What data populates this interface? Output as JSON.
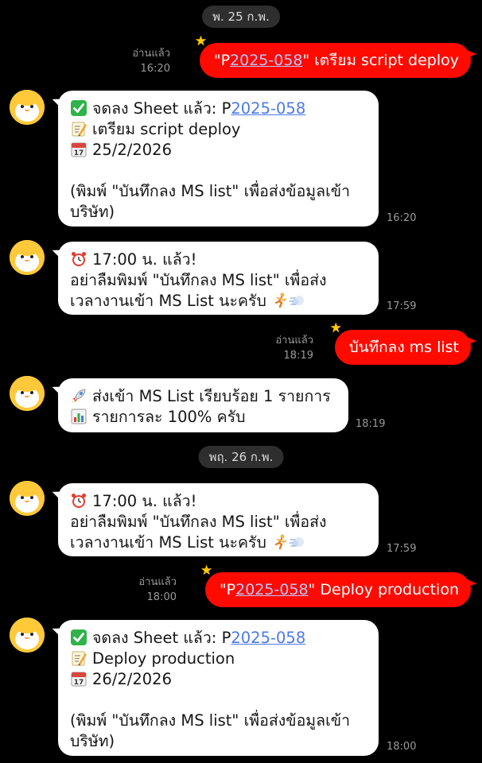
{
  "dates": {
    "d1": "พ. 25 ก.พ.",
    "d2": "พฤ. 26 ก.พ."
  },
  "read_label": "อ่านแล้ว",
  "outgoing": [
    {
      "time": "16:20",
      "pre": "\"P",
      "link": "2025-058",
      "post": "\" เตรียม script deploy"
    },
    {
      "time": "18:19",
      "text": "บันทึกลง ms list"
    },
    {
      "time": "18:00",
      "pre": "\"P",
      "link": "2025-058",
      "post": "\" Deploy production"
    }
  ],
  "incoming": [
    {
      "time": "16:20",
      "line1_pre": "จดลง Sheet แล้ว: P",
      "line1_link": "2025-058",
      "line2": "เตรียม script deploy",
      "line3": "25/2/2026",
      "line4": "(พิมพ์ \"บันทึกลง MS list\" เพื่อส่งข้อมูลเข้า",
      "line5": "บริษัท)"
    },
    {
      "time": "17:59",
      "line1": "17:00 น. แล้ว!",
      "line2": "อย่าลืมพิมพ์ \"บันทึกลง MS list\" เพื่อส่ง",
      "line3": "เวลางานเข้า MS List นะครับ"
    },
    {
      "time": "18:19",
      "line1": "ส่งเข้า MS List เรียบร้อย 1 รายการ",
      "line2": "รายการละ 100% ครับ"
    },
    {
      "time": "17:59",
      "line1": "17:00 น. แล้ว!",
      "line2": "อย่าลืมพิมพ์ \"บันทึกลง MS list\" เพื่อส่ง",
      "line3": "เวลางานเข้า MS List นะครับ"
    },
    {
      "time": "18:00",
      "line1_pre": "จดลง Sheet แล้ว: P",
      "line1_link": "2025-058",
      "line2": "Deploy production",
      "line3": "26/2/2026",
      "line4": "(พิมพ์ \"บันทึกลง MS list\" เพื่อส่งข้อมูลเข้า",
      "line5": "บริษัท)"
    }
  ],
  "icons": {
    "check": "check-mark-icon",
    "memo": "memo-icon",
    "calendar": "calendar-icon",
    "alarm": "alarm-clock-icon",
    "runner": "running-person-icon",
    "dash": "dash-icon",
    "rocket": "rocket-icon",
    "chart": "bar-chart-icon",
    "star": "star-icon",
    "avatar": "bot-avatar"
  },
  "colors": {
    "outgoing_bubble": "#ff0a00",
    "incoming_bubble": "#ffffff",
    "background": "#000000",
    "link": "#4a79e8"
  }
}
